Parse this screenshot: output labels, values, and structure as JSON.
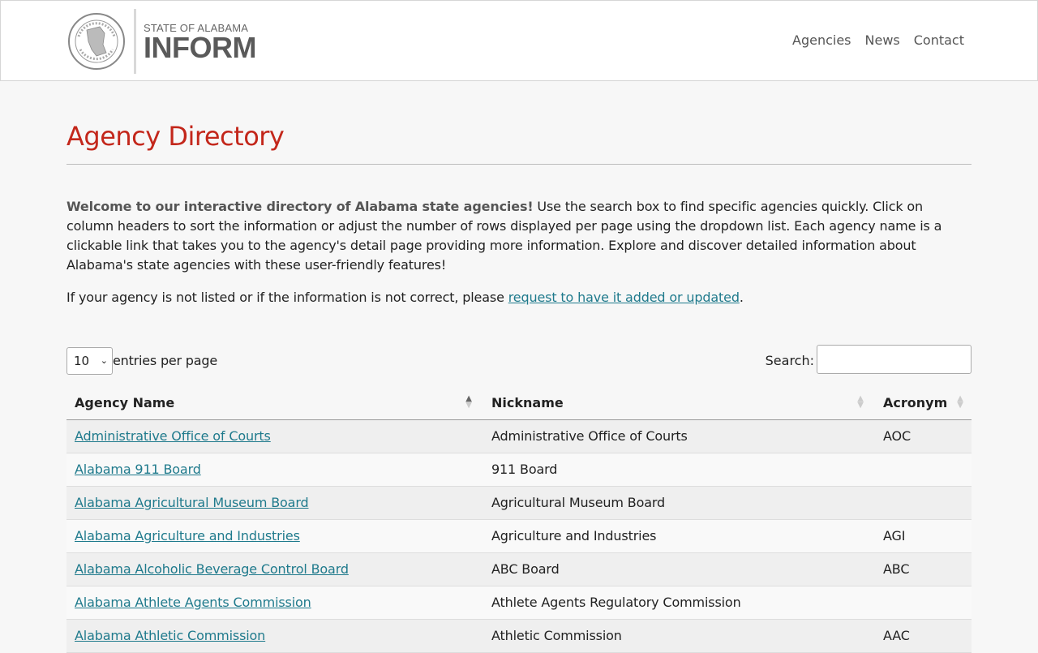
{
  "header": {
    "logo": {
      "seal_icon": "alabama-great-seal",
      "small_text": "STATE OF ALABAMA",
      "big_text": "INFORM"
    },
    "nav": [
      "Agencies",
      "News",
      "Contact"
    ]
  },
  "page": {
    "title": "Agency Directory",
    "intro_bold": "Welcome to our interactive directory of Alabama state agencies!",
    "intro_rest": " Use the search box to find specific agencies quickly. Click on column headers to sort the information or adjust the number of rows displayed per page using the dropdown list. Each agency name is a clickable link that takes you to the agency's detail page providing more information. Explore and discover detailed information about Alabama's state agencies with these user-friendly features!",
    "note_prefix": "If your agency is not listed or if the information is not correct, please ",
    "note_link": "request to have it added or updated",
    "note_suffix": "."
  },
  "controls": {
    "page_length": "10",
    "page_length_label": "entries per page",
    "search_label": "Search:",
    "search_value": ""
  },
  "table": {
    "columns": [
      "Agency Name",
      "Nickname",
      "Acronym"
    ],
    "rows": [
      {
        "name": "Administrative Office of Courts",
        "nickname": "Administrative Office of Courts",
        "acronym": "AOC"
      },
      {
        "name": "Alabama 911 Board",
        "nickname": "911 Board",
        "acronym": ""
      },
      {
        "name": "Alabama Agricultural Museum Board",
        "nickname": "Agricultural Museum Board",
        "acronym": ""
      },
      {
        "name": "Alabama Agriculture and Industries",
        "nickname": "Agriculture and Industries",
        "acronym": "AGI"
      },
      {
        "name": "Alabama Alcoholic Beverage Control Board",
        "nickname": "ABC Board",
        "acronym": "ABC"
      },
      {
        "name": "Alabama Athlete Agents Commission",
        "nickname": "Athlete Agents Regulatory Commission",
        "acronym": ""
      },
      {
        "name": "Alabama Athletic Commission",
        "nickname": "Athletic Commission",
        "acronym": "AAC"
      }
    ]
  },
  "colors": {
    "title": "#c3271b",
    "link": "#1f7a8c"
  }
}
